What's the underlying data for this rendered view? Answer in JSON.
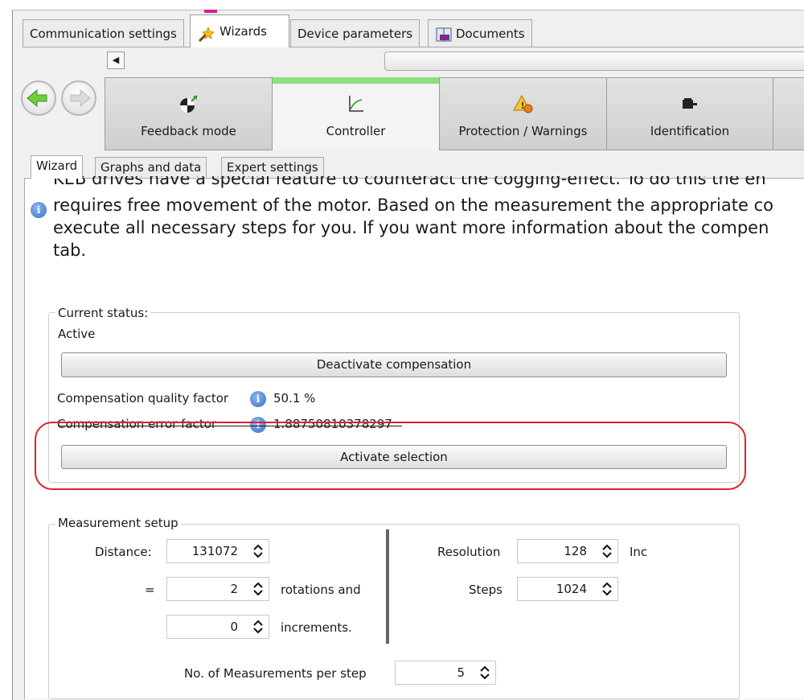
{
  "top_tabs": [
    {
      "label": "Communication settings",
      "icon": ""
    },
    {
      "label": "Wizards",
      "icon": "wizard-wand-icon"
    },
    {
      "label": "Device parameters",
      "icon": ""
    },
    {
      "label": "Documents",
      "icon": "keb-book-icon"
    }
  ],
  "top_tabs_active": "Wizards",
  "wizard_steps": [
    {
      "label": "Feedback mode",
      "icon": "feedback-encoder-icon"
    },
    {
      "label": "Controller",
      "icon": "controller-curve-icon",
      "active": true
    },
    {
      "label": "Protection / Warnings",
      "icon": "warning-triangle-icon"
    },
    {
      "label": "Identification",
      "icon": "motor-icon"
    }
  ],
  "sub_tabs": [
    "Wizard",
    "Graphs and data",
    "Expert settings"
  ],
  "sub_tabs_active": "Wizard",
  "info": {
    "line1": "KEB drives have a special feature to counteract the cogging-effect. To do this the en",
    "line2": "requires free movement of the motor. Based on the measurement the appropriate co",
    "line3": "execute all necessary steps for you. If you want more information about the compen",
    "line4": "tab."
  },
  "status": {
    "group_title": "Current status:",
    "state": "Active",
    "deactivate_label": "Deactivate compensation",
    "quality_label": "Compensation quality factor",
    "quality_value": "50.1 %",
    "error_label": "Compensation error factor",
    "error_value": "1.88750810378297",
    "activate_label": "Activate selection"
  },
  "measurement": {
    "group_title": "Measurement setup",
    "distance_label": "Distance:",
    "distance_value": "131072",
    "equals_label": "=",
    "rotations_value": "2",
    "rotations_label": "rotations and",
    "increments_value": "0",
    "increments_label": "increments.",
    "resolution_label": "Resolution",
    "resolution_value": "128",
    "resolution_unit": "Inc",
    "steps_label": "Steps",
    "steps_value": "1024",
    "measurements_label": "No. of Measurements per step",
    "measurements_value": "5"
  },
  "colors": {
    "highlight_red": "#e0202e",
    "active_step_green": "#8ee07f",
    "info_blue": "#3e6fc5"
  }
}
